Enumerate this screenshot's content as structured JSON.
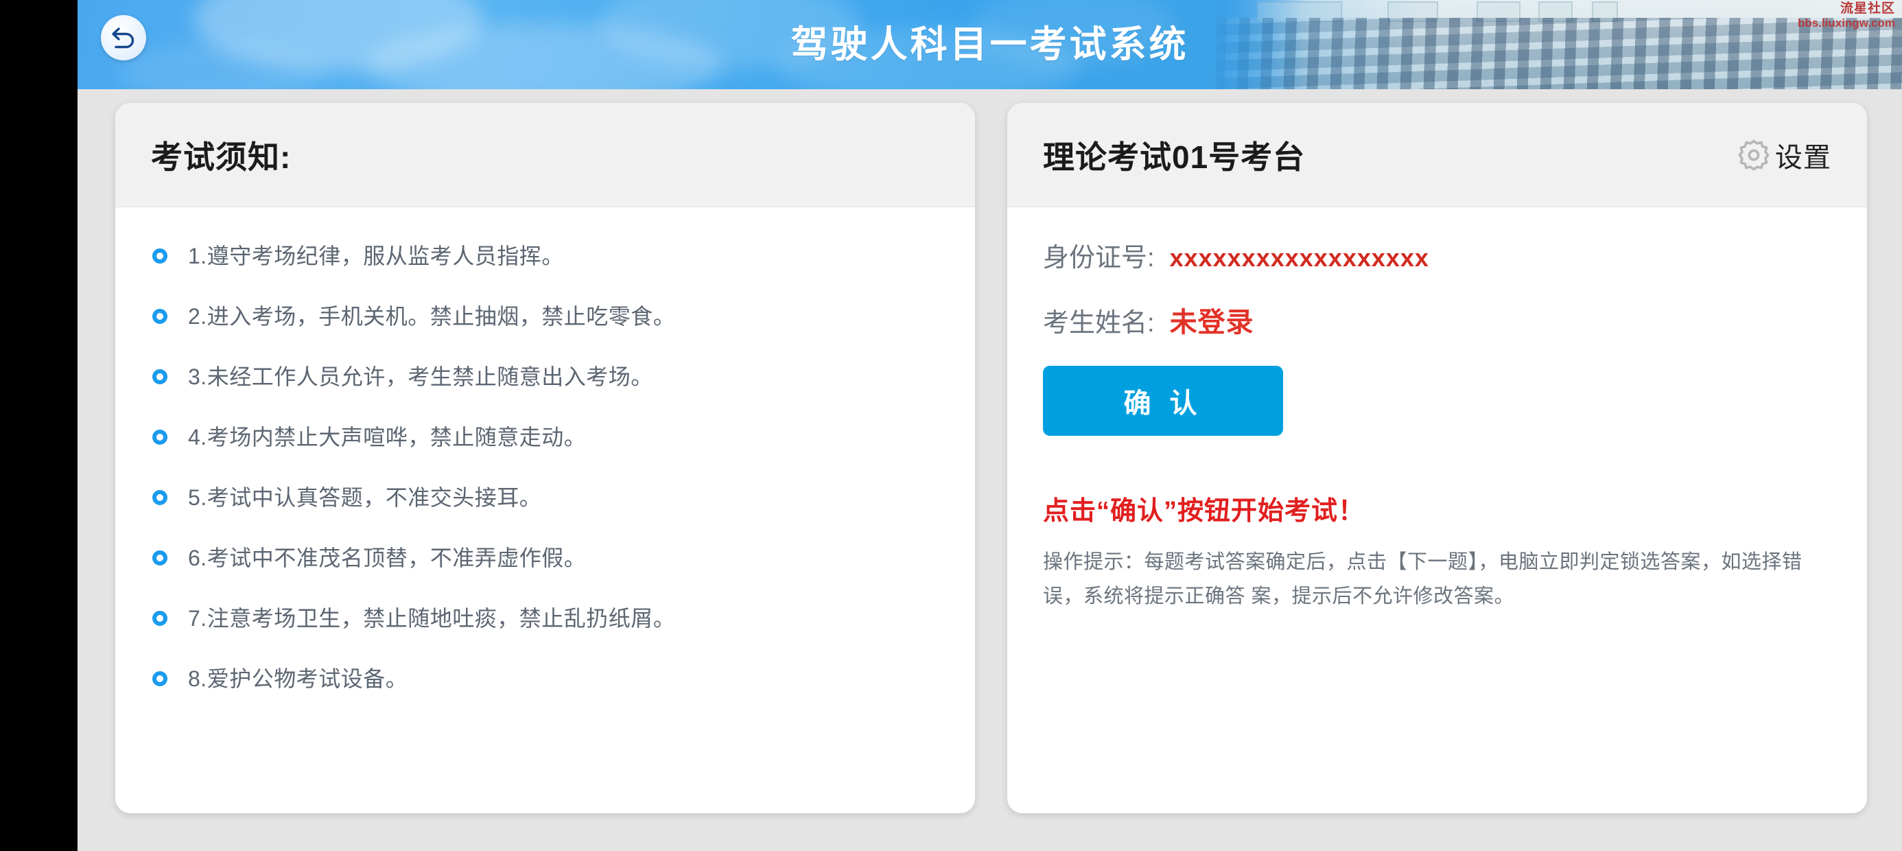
{
  "header": {
    "title": "驾驶人科目一考试系统",
    "back_icon": "back-arrow-icon",
    "watermark_cn": "流星社区",
    "watermark_en": "bbs.liuxingw.com"
  },
  "notice_card": {
    "title": "考试须知:",
    "items": [
      "1.遵守考场纪律，服从监考人员指挥。",
      "2.进入考场，手机关机。禁止抽烟，禁止吃零食。",
      "3.未经工作人员允许，考生禁止随意出入考场。",
      "4.考场内禁止大声喧哗，禁止随意走动。",
      "5.考试中认真答题，不准交头接耳。",
      "6.考试中不准茂名顶替，不准弄虚作假。",
      "7.注意考场卫生，禁止随地吐痰，禁止乱扔纸屑。",
      "8.爱护公物考试设备。"
    ]
  },
  "exam_card": {
    "title": "理论考试01号考台",
    "settings_label": "设置",
    "settings_icon": "gear-icon",
    "id_label": "身份证号:",
    "id_value": "xxxxxxxxxxxxxxxxxx",
    "name_label": "考生姓名:",
    "name_value": "未登录",
    "confirm_label": "确 认",
    "start_hint": "点击“确认”按钮开始考试！",
    "operation_hint": "操作提示：每题考试答案确定后，点击【下一题】，电脑立即判定锁选答案，如选择错误，系统将提示正确答 案，提示后不允许修改答案。"
  },
  "colors": {
    "accent_blue": "#00a0e0",
    "bullet_blue": "#1b9bed",
    "alert_red": "#e11f1f",
    "value_red": "#d22b20",
    "page_bg": "#e4e4e4",
    "card_head_bg": "#f1f1f1",
    "text_gray": "#6b747e"
  }
}
